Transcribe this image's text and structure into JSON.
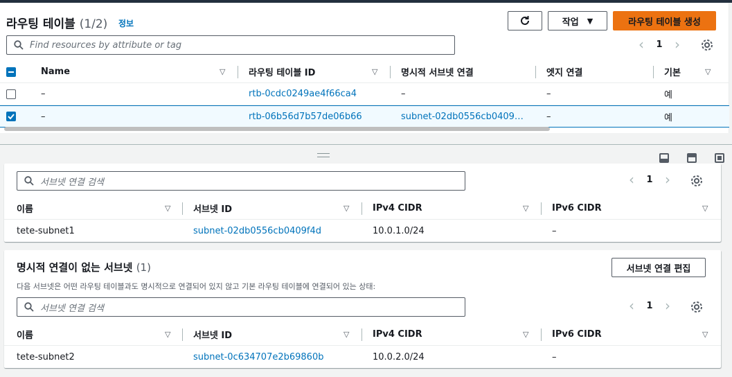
{
  "route_tables": {
    "title": "라우팅 테이블",
    "count": "(1/2)",
    "info_link": "정보",
    "actions_label": "작업",
    "create_label": "라우팅 테이블 생성",
    "search_placeholder": "Find resources by attribute or tag",
    "page": "1",
    "columns": [
      "Name",
      "라우팅 테이블 ID",
      "명시적 서브넷 연결",
      "엣지 연결",
      "기본"
    ],
    "rows": [
      {
        "name": "–",
        "id": "rtb-0cdc0249ae4f66ca4",
        "subnet": "–",
        "edge": "–",
        "main": "예",
        "selected": false
      },
      {
        "name": "–",
        "id": "rtb-06b56d7b57de06b66",
        "subnet": "subnet-02db0556cb0409…",
        "edge": "–",
        "main": "예",
        "selected": true
      }
    ]
  },
  "explicit_subnets": {
    "search_placeholder": "서브넷 연결 검색",
    "page": "1",
    "columns": [
      "이름",
      "서브넷 ID",
      "IPv4 CIDR",
      "IPv6 CIDR"
    ],
    "rows": [
      {
        "name": "tete-subnet1",
        "subnet_id": "subnet-02db0556cb0409f4d",
        "ipv4": "10.0.1.0/24",
        "ipv6": "–"
      }
    ]
  },
  "implicit_subnets": {
    "title": "명시적 연결이 없는 서브넷",
    "count": "(1)",
    "edit_label": "서브넷 연결 편집",
    "description": "다음 서브넷은 어떤 라우팅 테이블과도 명시적으로 연결되어 있지 않고 기본 라우팅 테이블에 연결되어 있는 상태:",
    "search_placeholder": "서브넷 연결 검색",
    "page": "1",
    "columns": [
      "이름",
      "서브넷 ID",
      "IPv4 CIDR",
      "IPv6 CIDR"
    ],
    "rows": [
      {
        "name": "tete-subnet2",
        "subnet_id": "subnet-0c634707e2b69860b",
        "ipv4": "10.0.2.0/24",
        "ipv6": "–"
      }
    ]
  },
  "colors": {
    "accent": "#ec7211",
    "link": "#0073bb",
    "selected_bg": "#f1faff"
  }
}
